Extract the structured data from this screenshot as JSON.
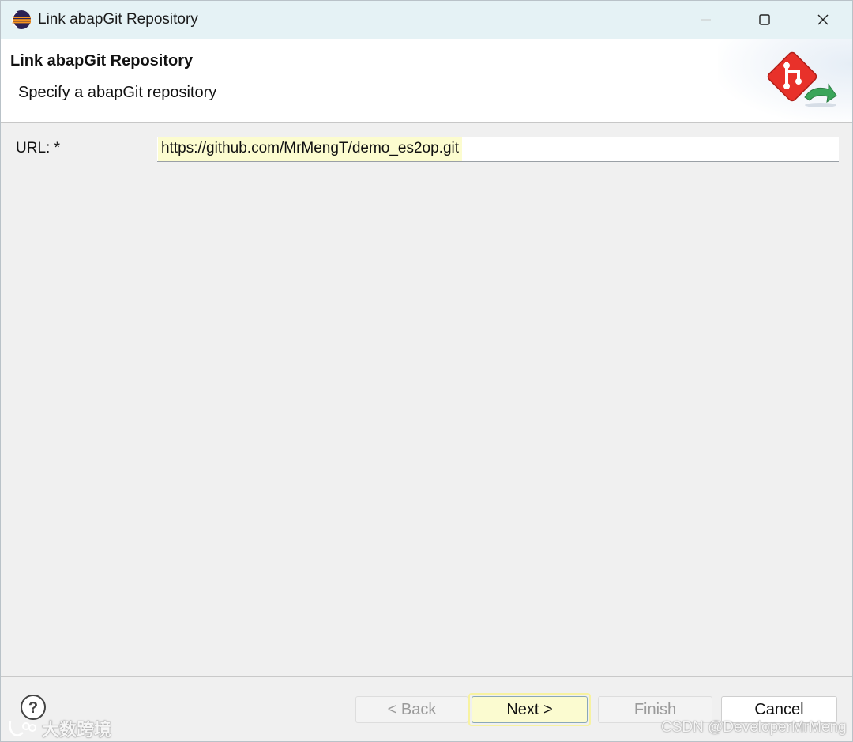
{
  "window": {
    "title": "Link abapGit Repository",
    "controls": {
      "minimize": "—",
      "maximize": "☐",
      "close": "✕"
    }
  },
  "banner": {
    "title": "Link abapGit Repository",
    "subtitle": "Specify a abapGit repository",
    "icon": "abapgit-link-wizard-icon"
  },
  "form": {
    "url_label": "URL: *",
    "url_value": "https://github.com/MrMengT/demo_es2op.git"
  },
  "buttons": {
    "help": "?",
    "back": "< Back",
    "next": "Next >",
    "finish": "Finish",
    "cancel": "Cancel",
    "back_enabled": false,
    "finish_enabled": false
  },
  "watermarks": {
    "left": "大数跨境",
    "right": "CSDN @DeveloperMrMeng"
  },
  "colors": {
    "titlebar": "#e5f2f5",
    "field_highlight": "#fcfccf",
    "abapgit_red": "#e8312a",
    "accent_green": "#3aa55a"
  }
}
